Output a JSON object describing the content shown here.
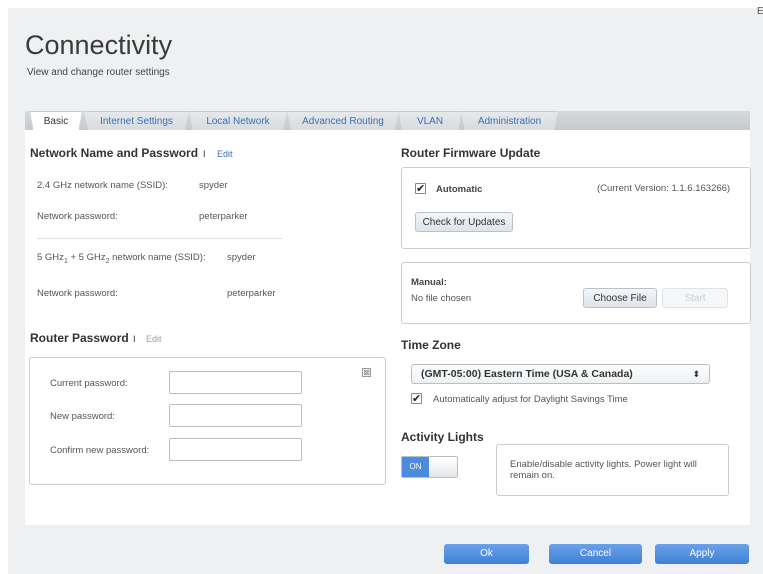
{
  "header": {
    "title": "Connectivity",
    "subtitle": "View and change router settings",
    "close_glyph": "E"
  },
  "tabs": [
    {
      "label": "Basic",
      "active": true
    },
    {
      "label": "Internet Settings",
      "active": false
    },
    {
      "label": "Local Network",
      "active": false
    },
    {
      "label": "Advanced Routing",
      "active": false
    },
    {
      "label": "VLAN",
      "active": false
    },
    {
      "label": "Administration",
      "active": false
    }
  ],
  "network": {
    "title": "Network Name and Password",
    "separator": "I",
    "edit_label": "Edit",
    "ssid24_label": "2.4 GHz network name (SSID):",
    "ssid24_value": "spyder",
    "password24_label": "Network password:",
    "password24_value": "peterparker",
    "ssid5_label_prefix": "5 GHz",
    "ssid5_sub1": "1",
    "ssid5_mid": " + 5 GHz",
    "ssid5_sub2": "2",
    "ssid5_label_suffix": " network name (SSID):",
    "ssid5_value": "spyder",
    "password5_label": "Network password:",
    "password5_value": "peterparker"
  },
  "router_password": {
    "title": "Router Password",
    "separator": "I",
    "edit_label": "Edit",
    "current_label": "Current password:",
    "new_label": "New password:",
    "confirm_label": "Confirm new password:",
    "current_value": "",
    "new_value": "",
    "confirm_value": "",
    "close_icon": "⊠"
  },
  "firmware": {
    "title": "Router Firmware Update",
    "automatic_label": "Automatic",
    "automatic_checked": true,
    "current_version": "(Current Version: 1.1.6.163266)",
    "check_button": "Check for Updates",
    "manual_label": "Manual:",
    "file_status": "No file chosen",
    "choose_file_button": "Choose File",
    "start_button": "Start"
  },
  "timezone": {
    "title": "Time Zone",
    "selected": "(GMT-05:00) Eastern Time (USA & Canada)",
    "dst_label": "Automatically adjust for Daylight Savings Time",
    "dst_checked": true
  },
  "activity_lights": {
    "title": "Activity Lights",
    "toggle_label": "ON",
    "toggle_on": true,
    "description": "Enable/disable activity lights. Power light will remain on."
  },
  "footer": {
    "ok_button": "Ok",
    "cancel_button": "Cancel",
    "apply_button": "Apply"
  },
  "colors": {
    "accent": "#3a70b5",
    "button_blue": "#4a8cdd",
    "panel_bg": "#eef0f2"
  },
  "icons": {
    "checkbox_checked": "✔",
    "select_arrows": "⬍"
  }
}
